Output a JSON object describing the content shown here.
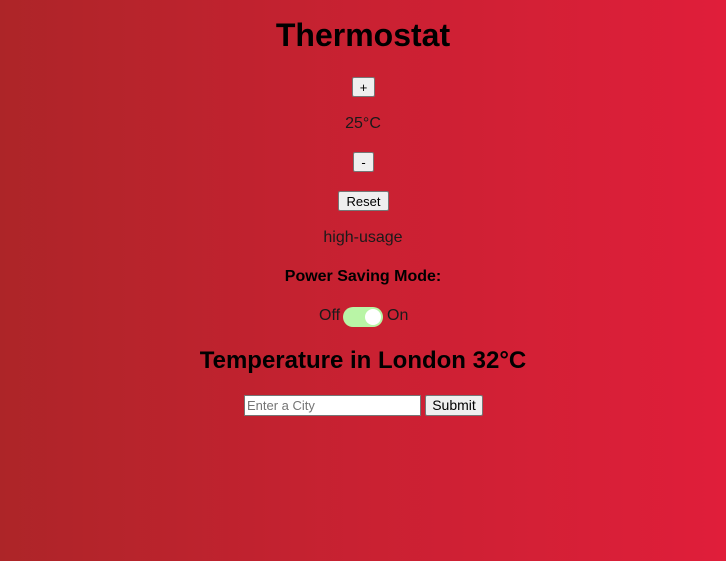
{
  "app": {
    "title": "Thermostat"
  },
  "controls": {
    "increase_label": "+",
    "temperature": "25°C",
    "decrease_label": "-",
    "reset_label": "Reset"
  },
  "usage": {
    "status": "high-usage"
  },
  "power_saving": {
    "label": "Power Saving Mode:",
    "off_label": "Off",
    "on_label": "On",
    "enabled": true,
    "toggle_color": "#b9f5a6"
  },
  "weather": {
    "heading": "Temperature in London 32°C"
  },
  "city_form": {
    "placeholder": "Enter a City",
    "value": "",
    "submit_label": "Submit"
  },
  "colors": {
    "background_start": "#ad2528",
    "background_end": "#e01e3a"
  }
}
